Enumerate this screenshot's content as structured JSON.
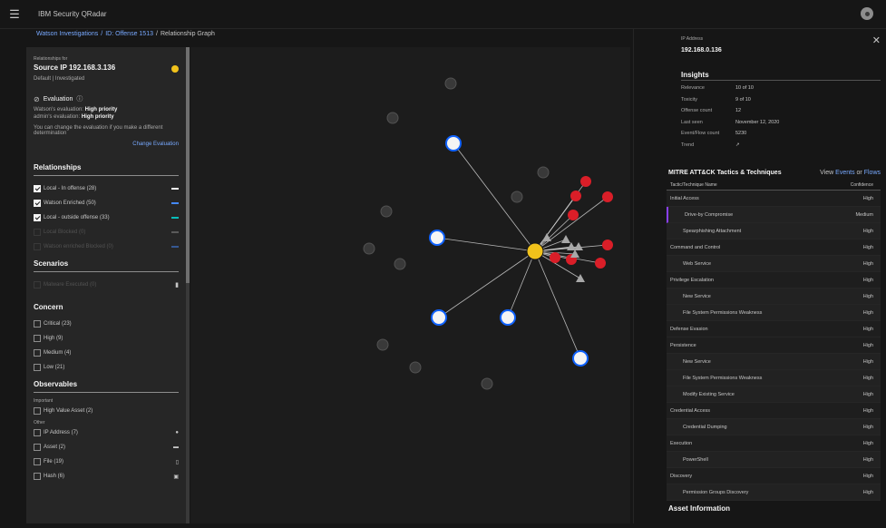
{
  "app": {
    "title": "IBM Security QRadar"
  },
  "breadcrumb": {
    "item1": "Watson Investigations",
    "sep1": "/",
    "item2": "ID: Offense 1513",
    "sep2": "/",
    "current": "Relationship Graph"
  },
  "left": {
    "rel_for": "Relationships for",
    "source_title": "Source IP 192.168.3.136",
    "status": "Default | Investigated",
    "evaluation": {
      "title": "Evaluation",
      "line1_prefix": "Watson's evaluation:",
      "line1_value": "High priority",
      "line2_prefix": "admin's evaluation:",
      "line2_value": "High priority",
      "note": "You can change the evaluation if you make a different determination",
      "change_link": "Change Evaluation"
    },
    "relationships": {
      "title": "Relationships",
      "items": [
        {
          "label": "Local - In offense (28)",
          "checked": true,
          "disabled": false,
          "color": "#f4f4f4"
        },
        {
          "label": "Watson Enriched (50)",
          "checked": true,
          "disabled": false,
          "color": "#4589ff"
        },
        {
          "label": "Local - outside offense (33)",
          "checked": true,
          "disabled": false,
          "color": "#08bdba"
        },
        {
          "label": "Local Blocked (0)",
          "checked": false,
          "disabled": true,
          "color": "#8d8d8d"
        },
        {
          "label": "Watson enriched Blocked (0)",
          "checked": false,
          "disabled": true,
          "color": "#4589ff"
        }
      ]
    },
    "scenarios": {
      "title": "Scenarios",
      "items": [
        {
          "label": "Malware Executed (0)",
          "disabled": true
        }
      ]
    },
    "concern": {
      "title": "Concern",
      "items": [
        {
          "label": "Critical (23)"
        },
        {
          "label": "High (9)"
        },
        {
          "label": "Medium (4)"
        },
        {
          "label": "Low (21)"
        }
      ]
    },
    "observables": {
      "title": "Observables",
      "important_label": "Important",
      "important_items": [
        {
          "label": "High Value Asset (2)"
        }
      ],
      "other_label": "Other",
      "other_items": [
        {
          "label": "IP Address (7)",
          "icon": "ip-icon"
        },
        {
          "label": "Asset (2)",
          "icon": "asset-icon"
        },
        {
          "label": "File (19)",
          "icon": "file-icon"
        },
        {
          "label": "Hash (6)",
          "icon": "hash-icon"
        }
      ]
    }
  },
  "right": {
    "ip_label": "IP Address",
    "ip_value": "192.168.0.136",
    "insights": {
      "title": "Insights",
      "rows": [
        {
          "key": "Relevance",
          "value": "10 of 10"
        },
        {
          "key": "Toxicity",
          "value": "9 of 10"
        },
        {
          "key": "Offense count",
          "value": "12"
        },
        {
          "key": "Last seen",
          "value": "November 12, 2020"
        },
        {
          "key": "Event/Flow count",
          "value": "5230"
        },
        {
          "key": "Trend",
          "value": "↗"
        }
      ]
    },
    "mitre": {
      "title": "MITRE ATT&CK Tactics & Techniques",
      "view": "View",
      "events": "Events",
      "or": "or",
      "flows": "Flows",
      "col_name": "Tactic/Technique Name",
      "col_conf": "Confidence",
      "rows": [
        {
          "name": "Initial Access",
          "conf": "High",
          "kind": "tactic"
        },
        {
          "name": "Drive-by Compromise",
          "conf": "Medium",
          "kind": "technique",
          "selected": true
        },
        {
          "name": "Spearphishing Attachment",
          "conf": "High",
          "kind": "technique"
        },
        {
          "name": "Command and Control",
          "conf": "High",
          "kind": "tactic"
        },
        {
          "name": "Web Service",
          "conf": "High",
          "kind": "technique"
        },
        {
          "name": "Privilege Escalation",
          "conf": "High",
          "kind": "tactic"
        },
        {
          "name": "New Service",
          "conf": "High",
          "kind": "technique"
        },
        {
          "name": "File System Permissions Weakness",
          "conf": "High",
          "kind": "technique"
        },
        {
          "name": "Defense Evasion",
          "conf": "High",
          "kind": "tactic"
        },
        {
          "name": "Persistence",
          "conf": "High",
          "kind": "tactic"
        },
        {
          "name": "New Service",
          "conf": "High",
          "kind": "technique"
        },
        {
          "name": "File System Permissions Weakness",
          "conf": "High",
          "kind": "technique"
        },
        {
          "name": "Modify Existing Service",
          "conf": "High",
          "kind": "technique"
        },
        {
          "name": "Credential Access",
          "conf": "High",
          "kind": "tactic"
        },
        {
          "name": "Credential Dumping",
          "conf": "High",
          "kind": "technique"
        },
        {
          "name": "Execution",
          "conf": "High",
          "kind": "tactic"
        },
        {
          "name": "PowerShell",
          "conf": "High",
          "kind": "technique"
        },
        {
          "name": "Discovery",
          "conf": "High",
          "kind": "tactic"
        },
        {
          "name": "Permission Groups Discovery",
          "conf": "High",
          "kind": "technique"
        }
      ]
    },
    "asset_info": "Asset Information"
  }
}
